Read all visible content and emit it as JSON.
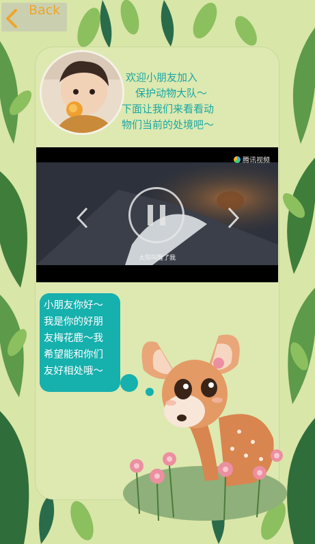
{
  "header": {
    "back_label": "Back"
  },
  "welcome": {
    "lines": [
      "欢迎小朋友加入",
      "保护动物大队～",
      "下面让我们来看看动",
      "物们当前的处境吧～"
    ]
  },
  "video": {
    "logo_text": "腾讯视频",
    "subtitle": "太阳叫醒了我"
  },
  "speech": {
    "lines": [
      "小朋友你好～",
      "我是你的好朋",
      "友梅花鹿～我",
      "希望能和你们",
      "友好相处哦～"
    ]
  },
  "colors": {
    "accent_teal": "#16b0ad",
    "back_orange": "#f0a020",
    "background_green": "#d8e6a8"
  }
}
